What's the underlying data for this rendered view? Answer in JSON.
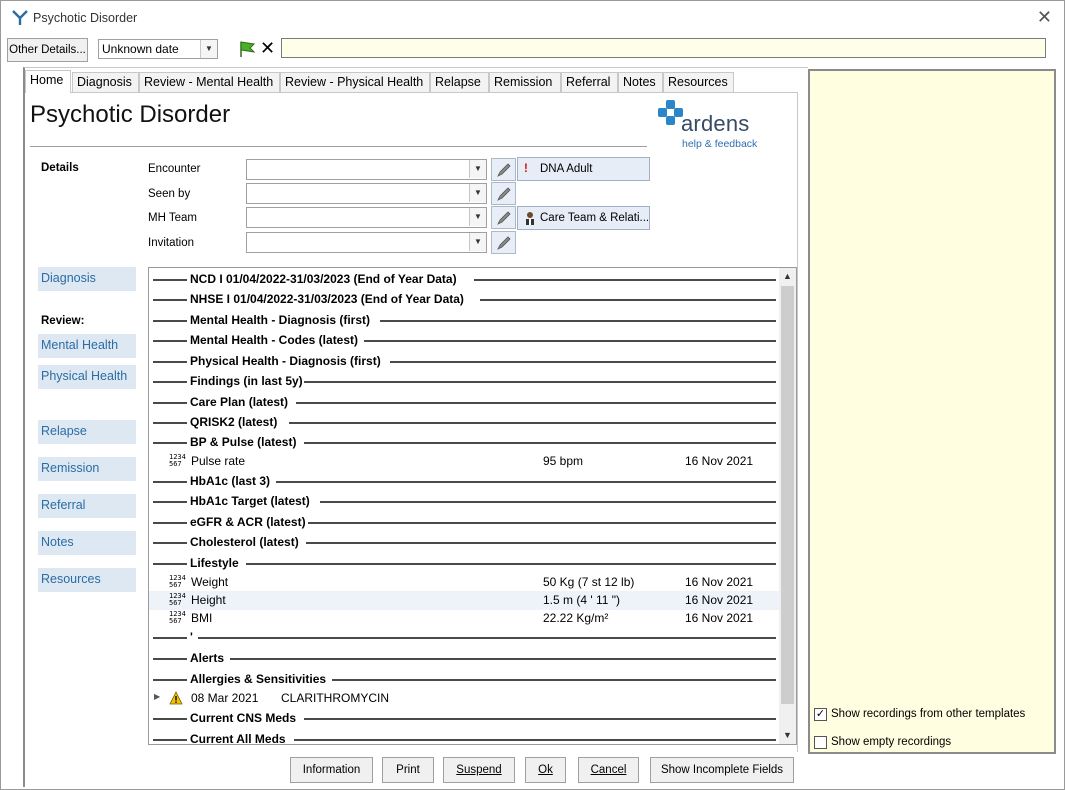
{
  "window": {
    "title": "Psychotic Disorder"
  },
  "toolbar": {
    "other_details": "Other Details...",
    "date_value": "Unknown date",
    "free_text": ""
  },
  "tabs": [
    "Home",
    "Diagnosis",
    "Review - Mental Health",
    "Review - Physical Health",
    "Relapse",
    "Remission",
    "Referral",
    "Notes",
    "Resources"
  ],
  "page": {
    "title": "Psychotic Disorder",
    "logo": {
      "word": "ardens",
      "sub": "help & feedback"
    }
  },
  "details": {
    "label": "Details",
    "fields": [
      {
        "label": "Encounter",
        "value": ""
      },
      {
        "label": "Seen by",
        "value": ""
      },
      {
        "label": "MH Team",
        "value": ""
      },
      {
        "label": "Invitation",
        "value": ""
      }
    ],
    "dna_button": "DNA Adult",
    "care_team_button": "Care Team & Relati..."
  },
  "left_nav": {
    "diagnosis": "Diagnosis",
    "review_label": "Review:",
    "mental_health": "Mental Health",
    "physical_health": "Physical Health",
    "relapse": "Relapse",
    "remission": "Remission",
    "referral": "Referral",
    "notes": "Notes",
    "resources": "Resources"
  },
  "list": {
    "sections": [
      "NCD I 01/04/2022-31/03/2023 (End of Year Data)",
      "NHSE I 01/04/2022-31/03/2023 (End of Year Data)",
      "Mental Health - Diagnosis (first)",
      "Mental Health - Codes (latest)",
      "Physical Health - Diagnosis (first)",
      "Findings (in last 5y)",
      "Care Plan (latest)",
      "QRISK2 (latest)",
      "BP & Pulse (latest)",
      "HbA1c (last 3)",
      "HbA1c Target (latest)",
      "eGFR & ACR (latest)",
      "Cholesterol (latest)",
      "Lifestyle",
      "'",
      "Alerts",
      "Allergies & Sensitivities",
      "Current CNS Meds",
      "Current All Meds"
    ],
    "pulse": {
      "name": "Pulse rate",
      "value": "95 bpm",
      "date": "16 Nov 2021"
    },
    "weight": {
      "name": "Weight",
      "value": "50 Kg (7 st 12 lb)",
      "date": "16 Nov 2021"
    },
    "height": {
      "name": "Height",
      "value": "1.5 m (4 ' 11 \")",
      "date": "16 Nov 2021"
    },
    "bmi": {
      "name": "BMI",
      "value": "22.22 Kg/m²",
      "date": "16 Nov 2021"
    },
    "allergy": {
      "date": "08 Mar 2021",
      "name": "CLARITHROMYCIN"
    },
    "numeric_icon": "1234 567"
  },
  "side_panel": {
    "show_other": "Show recordings from other templates",
    "show_empty": "Show empty recordings"
  },
  "buttons": {
    "information": "Information",
    "print": "Print",
    "suspend": "Suspend",
    "ok": "Ok",
    "cancel": "Cancel",
    "incomplete": "Show Incomplete Fields"
  }
}
